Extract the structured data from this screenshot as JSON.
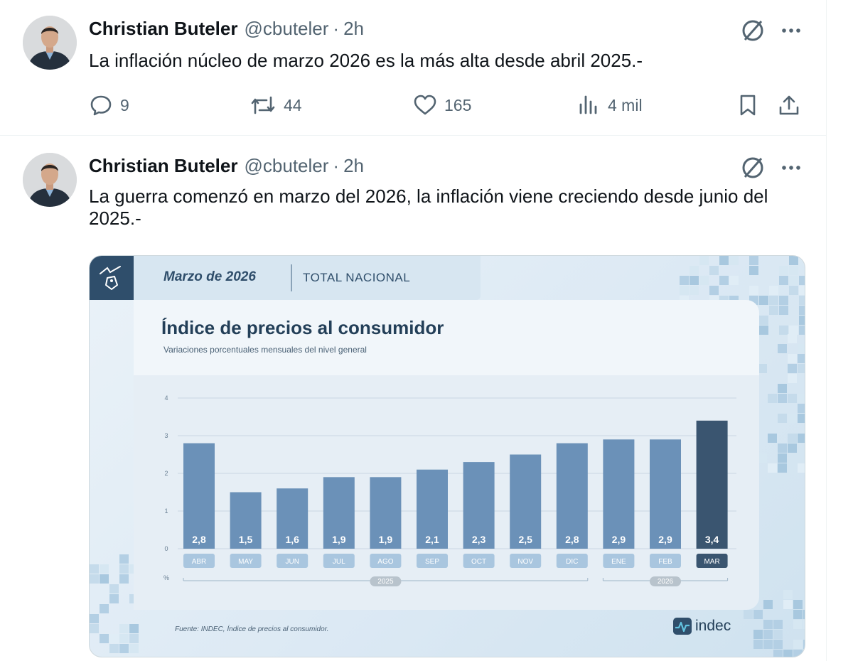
{
  "tweets": [
    {
      "author_name": "Christian Buteler",
      "handle": "@cbuteler",
      "separator": "·",
      "time": "2h",
      "text": "La inflación núcleo de marzo 2026 es la más alta desde abril 2025.-",
      "stats": {
        "replies": "9",
        "reposts": "44",
        "likes": "165",
        "views": "4 mil"
      }
    },
    {
      "author_name": "Christian Buteler",
      "handle": "@cbuteler",
      "separator": "·",
      "time": "2h",
      "text": "La guerra comenzó en marzo del 2026, la inflación viene creciendo desde junio del 2025.-",
      "media": {
        "tab_month": "Marzo de 2026",
        "tab_scope": "TOTAL NACIONAL",
        "source": "Fuente: INDEC, Índice de precios al consumidor.",
        "logo_text": "indec"
      }
    }
  ],
  "icons": {
    "reply": "speech-bubble-icon",
    "repost": "repost-arrows-icon",
    "like": "heart-icon",
    "views": "bar-chart-icon",
    "bookmark": "bookmark-icon",
    "share": "upload-icon",
    "grok": "grok-icon",
    "more": "more-dots-icon"
  },
  "colors": {
    "text_primary": "#0f1419",
    "text_secondary": "#536471",
    "bar": "#6b91b8",
    "bar_highlight": "#3a5570",
    "panel_dark": "#2f4e6b"
  },
  "chart_data": {
    "type": "bar",
    "title": "Índice de precios al consumidor",
    "subtitle": "Variaciones porcentuales mensuales del nivel general",
    "ylabel": "%",
    "ylim": [
      0,
      4
    ],
    "yticks": [
      "0",
      "1",
      "2",
      "3",
      "4"
    ],
    "categories": [
      "ABR",
      "MAY",
      "JUN",
      "JUL",
      "AGO",
      "SEP",
      "OCT",
      "NOV",
      "DIC",
      "ENE",
      "FEB",
      "MAR"
    ],
    "values": [
      2.8,
      1.5,
      1.6,
      1.9,
      1.9,
      2.1,
      2.3,
      2.5,
      2.8,
      2.9,
      2.9,
      3.4
    ],
    "value_labels": [
      "2,8",
      "1,5",
      "1,6",
      "1,9",
      "1,9",
      "2,1",
      "2,3",
      "2,5",
      "2,8",
      "2,9",
      "2,9",
      "3,4"
    ],
    "year_groups": [
      {
        "label": "2025",
        "from": "ABR",
        "to": "DIC"
      },
      {
        "label": "2026",
        "from": "ENE",
        "to": "MAR"
      }
    ],
    "highlight": "MAR",
    "grid": true,
    "legend": "none"
  }
}
